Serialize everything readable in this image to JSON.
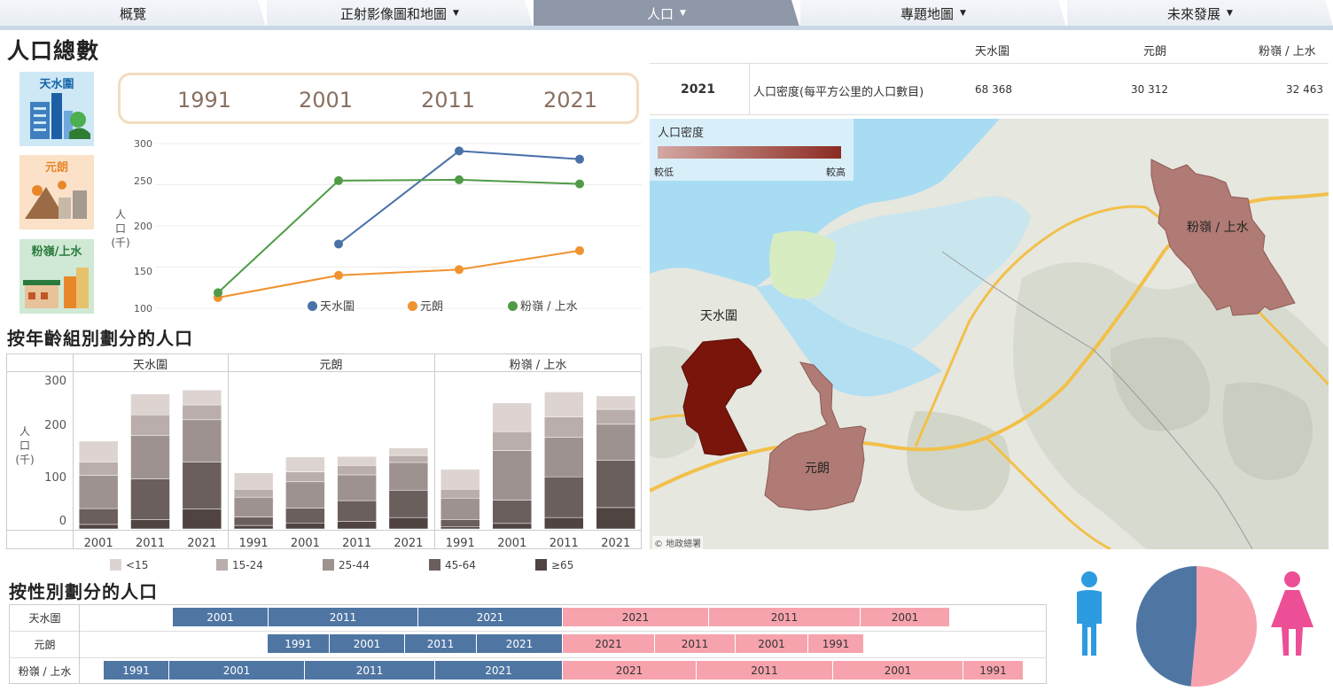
{
  "tabs": [
    {
      "label": "概覽",
      "dropdown": false,
      "active": false
    },
    {
      "label": "正射影像圖和地圖",
      "dropdown": true,
      "active": false
    },
    {
      "label": "人口",
      "dropdown": true,
      "active": true
    },
    {
      "label": "專題地圖",
      "dropdown": true,
      "active": false
    },
    {
      "label": "未來發展",
      "dropdown": true,
      "active": false
    }
  ],
  "total_section": {
    "title": "人口總數",
    "districts": [
      "天水圍",
      "元朗",
      "粉嶺/上水"
    ],
    "years": [
      "1991",
      "2001",
      "2011",
      "2021"
    ],
    "y_axis_label": [
      "人",
      "口",
      "(千)"
    ]
  },
  "density_table": {
    "columns": [
      "天水圍",
      "元朗",
      "粉嶺 / 上水"
    ],
    "year": "2021",
    "row_label": "人口密度(每平方公里的人口數目)",
    "values": [
      "68 368",
      "30 312",
      "32 463"
    ]
  },
  "map": {
    "legend_title": "人口密度",
    "legend_low": "較低",
    "legend_high": "較高",
    "labels": {
      "tsw": "天水圍",
      "yl": "元朗",
      "fl": "粉嶺 / 上水"
    },
    "credit": "© 地政總署",
    "colors": {
      "tsw": "#7a150b",
      "other": "#b07b74"
    }
  },
  "age_section": {
    "title": "按年齡組別劃分的人口",
    "groups": [
      "天水圍",
      "元朗",
      "粉嶺 / 上水"
    ],
    "y_axis_label": [
      "人",
      "口",
      "(千)"
    ],
    "legend": [
      "<15",
      "15-24",
      "25-44",
      "45-64",
      "≥65"
    ],
    "colors": [
      "#ddd4d1",
      "#b9aeab",
      "#9e9290",
      "#6b5f5d",
      "#4f4442"
    ]
  },
  "gender_section": {
    "title": "按性別劃分的人口",
    "rows": [
      {
        "label": "天水圍",
        "male": [
          "2001",
          "2011",
          "2021"
        ],
        "female": [
          "2021",
          "2011",
          "2001"
        ]
      },
      {
        "label": "元朗",
        "male": [
          "1991",
          "2001",
          "2011",
          "2021"
        ],
        "female": [
          "2021",
          "2011",
          "2001",
          "1991"
        ]
      },
      {
        "label": "粉嶺 / 上水",
        "male": [
          "1991",
          "2001",
          "2011",
          "2021"
        ],
        "female": [
          "2021",
          "2011",
          "2001",
          "1991"
        ]
      }
    ],
    "male_color": "#4f76a3",
    "female_color": "#f7a3ad"
  },
  "chart_data": [
    {
      "type": "line",
      "x": [
        "1991",
        "2001",
        "2011",
        "2021"
      ],
      "ylim": [
        100,
        300
      ],
      "yticks": [
        "100",
        "150",
        "200",
        "250",
        "300"
      ],
      "series": [
        {
          "name": "天水圍",
          "color": "#4a72a8",
          "values": [
            null,
            178,
            291,
            281
          ]
        },
        {
          "name": "元朗",
          "color": "#f0922f",
          "values": [
            113,
            140,
            147,
            170
          ]
        },
        {
          "name": "粉嶺 / 上水",
          "color": "#4f9b47",
          "values": [
            119,
            255,
            256,
            251
          ]
        }
      ],
      "grid": true
    },
    {
      "type": "bar",
      "stacked": true,
      "ylim": [
        0,
        300
      ],
      "yticks": [
        "0",
        "100",
        "200",
        "300"
      ],
      "categories_by_group": [
        [
          "2001",
          "2011",
          "2021"
        ],
        [
          "1991",
          "2001",
          "2011",
          "2021"
        ],
        [
          "1991",
          "2001",
          "2011",
          "2021"
        ]
      ],
      "series": [
        {
          "name": "<15",
          "values": [
            [
              42,
              42,
              30
            ],
            [
              33,
              30,
              18,
              15
            ],
            [
              40,
              58,
              50,
              27
            ]
          ]
        },
        {
          "name": "15-24",
          "values": [
            [
              27,
              42,
              30
            ],
            [
              16,
              20,
              19,
              14
            ],
            [
              18,
              38,
              41,
              30
            ]
          ]
        },
        {
          "name": "25-44",
          "values": [
            [
              67,
              87,
              85
            ],
            [
              40,
              53,
              52,
              56
            ],
            [
              43,
              100,
              80,
              73
            ]
          ]
        },
        {
          "name": "45-64",
          "values": [
            [
              32,
              82,
              95
            ],
            [
              17,
              30,
              42,
              55
            ],
            [
              15,
              47,
              82,
              95
            ]
          ]
        },
        {
          "name": "≥65",
          "values": [
            [
              9,
              19,
              40
            ],
            [
              7,
              12,
              15,
              23
            ],
            [
              4,
              11,
              23,
              43
            ]
          ]
        }
      ]
    },
    {
      "type": "pie",
      "slices": [
        {
          "name": "男",
          "value": 48.5,
          "color": "#4f76a3"
        },
        {
          "name": "女",
          "value": 51.5,
          "color": "#f7a3ad"
        }
      ]
    }
  ]
}
